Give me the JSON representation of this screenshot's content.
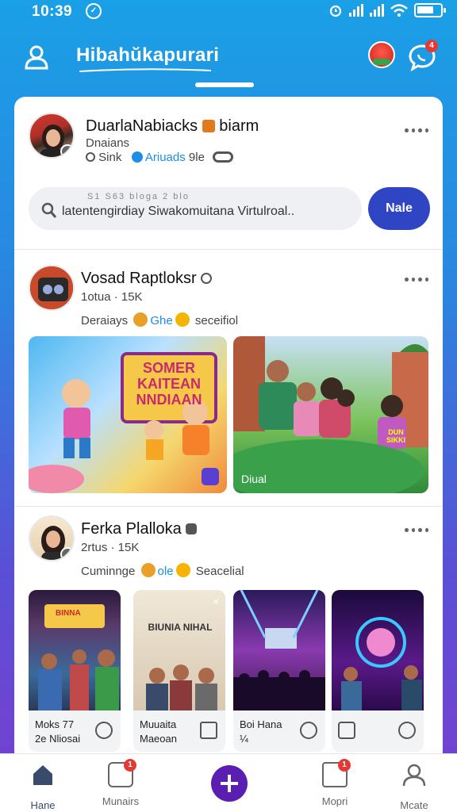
{
  "status": {
    "time": "10:39"
  },
  "app": {
    "title": "Hibahŭkapurari",
    "chat_badge": "4"
  },
  "composer": {
    "name": "DuarlaNabiacks",
    "name_suffix": "biarm",
    "meta1": "Dnaians",
    "meta2_a": "Sink",
    "meta2_b": "Ariuads",
    "meta2_c": "9le",
    "search_hint": "S1  S63 bloga   2 blo",
    "search_text": "latentengirdiay  Siwakomuitana Virtulroal..",
    "post_label": "Nale"
  },
  "posts": [
    {
      "name": "Vosad Raptloksr",
      "stats": "1otua · 15K",
      "reactions_prefix": "Deraiays",
      "reactions_word": "Ghe",
      "reactions_suffix": "seceifiol",
      "media": [
        {
          "title": "SOMER KAITEAN NNDIAAN"
        },
        {
          "caption": "Diual",
          "shirt": "DUN SIKKI"
        }
      ]
    },
    {
      "name": "Ferka Plalloka",
      "stats": "2rtus · 15K",
      "reactions_prefix": "Cuminnge",
      "reactions_word": "ole",
      "reactions_suffix": "Seacelial",
      "tiles": [
        {
          "line1": "Moks 77",
          "line2": "2e Nliosai",
          "sign": "BINNA"
        },
        {
          "line1": "Muuaita",
          "line2": "Maeoan",
          "sign": "BIUNIA NIHAL"
        },
        {
          "line1": "Boi Hana",
          "line2": "¼"
        },
        {
          "line1": "",
          "line2": ""
        }
      ]
    }
  ],
  "nav": [
    {
      "label": "Hane",
      "active": true
    },
    {
      "label": "Munairs",
      "badge": "1"
    },
    {
      "label": ""
    },
    {
      "label": "Mopri",
      "badge": "1"
    },
    {
      "label": "Mcate"
    }
  ],
  "colors": {
    "accent": "#2f45c4",
    "center": "#5a1fb0",
    "badge": "#e53935"
  }
}
